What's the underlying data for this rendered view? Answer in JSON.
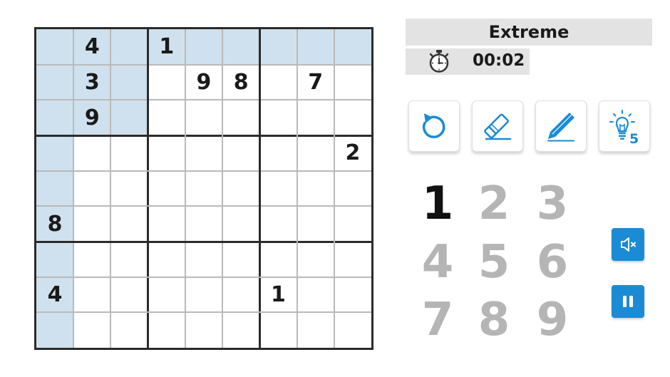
{
  "difficulty": "Extreme",
  "timer": "00:02",
  "board": {
    "cells": [
      [
        "",
        "4",
        "",
        "1",
        "",
        "",
        "",
        "",
        ""
      ],
      [
        "",
        "3",
        "",
        "",
        "9",
        "8",
        "",
        "7",
        ""
      ],
      [
        "",
        "9",
        "",
        "",
        "",
        "",
        "",
        "",
        ""
      ],
      [
        "",
        "",
        "",
        "",
        "",
        "",
        "",
        "",
        "2"
      ],
      [
        "",
        "",
        "",
        "",
        "",
        "",
        "",
        "",
        ""
      ],
      [
        "8",
        "",
        "",
        "",
        "",
        "",
        "",
        "",
        ""
      ],
      [
        "",
        "",
        "",
        "",
        "",
        "",
        "",
        "",
        ""
      ],
      [
        "4",
        "",
        "",
        "",
        "",
        "",
        "1",
        "",
        ""
      ],
      [
        "",
        "",
        "",
        "",
        "",
        "",
        "",
        "",
        ""
      ]
    ],
    "selected_cell": {
      "row": 0,
      "col": 0
    },
    "highlight_color": "#cfe1ee"
  },
  "tools": [
    {
      "name": "undo-icon",
      "label": ""
    },
    {
      "name": "eraser-icon",
      "label": ""
    },
    {
      "name": "pencil-icon",
      "label": ""
    },
    {
      "name": "hint-bulb-icon",
      "label": "5"
    }
  ],
  "numpad": {
    "numbers": [
      "1",
      "2",
      "3",
      "4",
      "5",
      "6",
      "7",
      "8",
      "9"
    ],
    "active": [
      "1"
    ],
    "active_color": "#111111",
    "inactive_color": "#b5b5b5"
  },
  "controls": [
    {
      "name": "mute-speaker-icon"
    },
    {
      "name": "pause-icon"
    }
  ],
  "colors": {
    "accent": "#1a8bd4",
    "header_bg": "#e3e3e3",
    "grid_border": "#2b2b2b"
  }
}
